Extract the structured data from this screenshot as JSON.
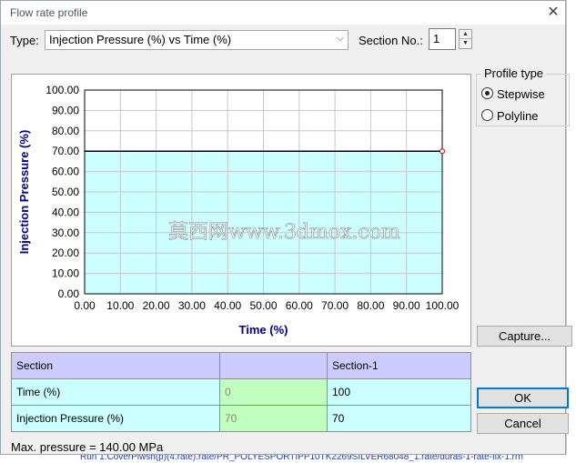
{
  "dialog": {
    "title": "Flow rate profile",
    "close": "✕"
  },
  "type_row": {
    "type_label": "Type:",
    "type_value": "Injection Pressure (%) vs Time (%)",
    "section_label": "Section No.:",
    "section_value": "1"
  },
  "profile_type": {
    "legend": "Profile type",
    "options": [
      {
        "label": "Stepwise",
        "selected": true
      },
      {
        "label": "Polyline",
        "selected": false
      }
    ]
  },
  "chart_data": {
    "type": "area",
    "xlabel": "Time (%)",
    "ylabel": "Injection Pressure (%)",
    "xlim": [
      0,
      100
    ],
    "ylim": [
      0,
      100
    ],
    "x_ticks": [
      "0.00",
      "10.00",
      "20.00",
      "30.00",
      "40.00",
      "50.00",
      "60.00",
      "70.00",
      "80.00",
      "90.00",
      "100.00"
    ],
    "y_ticks": [
      "0.00",
      "10.00",
      "20.00",
      "30.00",
      "40.00",
      "50.00",
      "60.00",
      "70.00",
      "80.00",
      "90.00",
      "100.00"
    ],
    "grid": true,
    "series": [
      {
        "x": [
          0,
          100
        ],
        "y": [
          70,
          70
        ],
        "step": true
      }
    ],
    "fill_color": "#ccffff",
    "line_color": "#000000",
    "marker_color": "#cc0000",
    "watermark": "莫西网www.3dmox.com"
  },
  "table": {
    "header": [
      "Section",
      "",
      "Section-1"
    ],
    "rows": [
      {
        "label": "Time (%)",
        "start": "0",
        "value": "100"
      },
      {
        "label": "Injection Pressure (%)",
        "start": "70",
        "value": "70"
      }
    ]
  },
  "buttons": {
    "capture": "Capture...",
    "ok": "OK",
    "cancel": "Cancel"
  },
  "status": {
    "max_pressure": "Max. pressure = 140.00 MPa"
  },
  "background": {
    "bottom_text": "Run 1:CoverPlwsh(p)(4.rate).rate/PR_POLYESPORTIPP10TK2269SILVER68048_1.rate/duras-1-rate-fix-1.rrn"
  }
}
